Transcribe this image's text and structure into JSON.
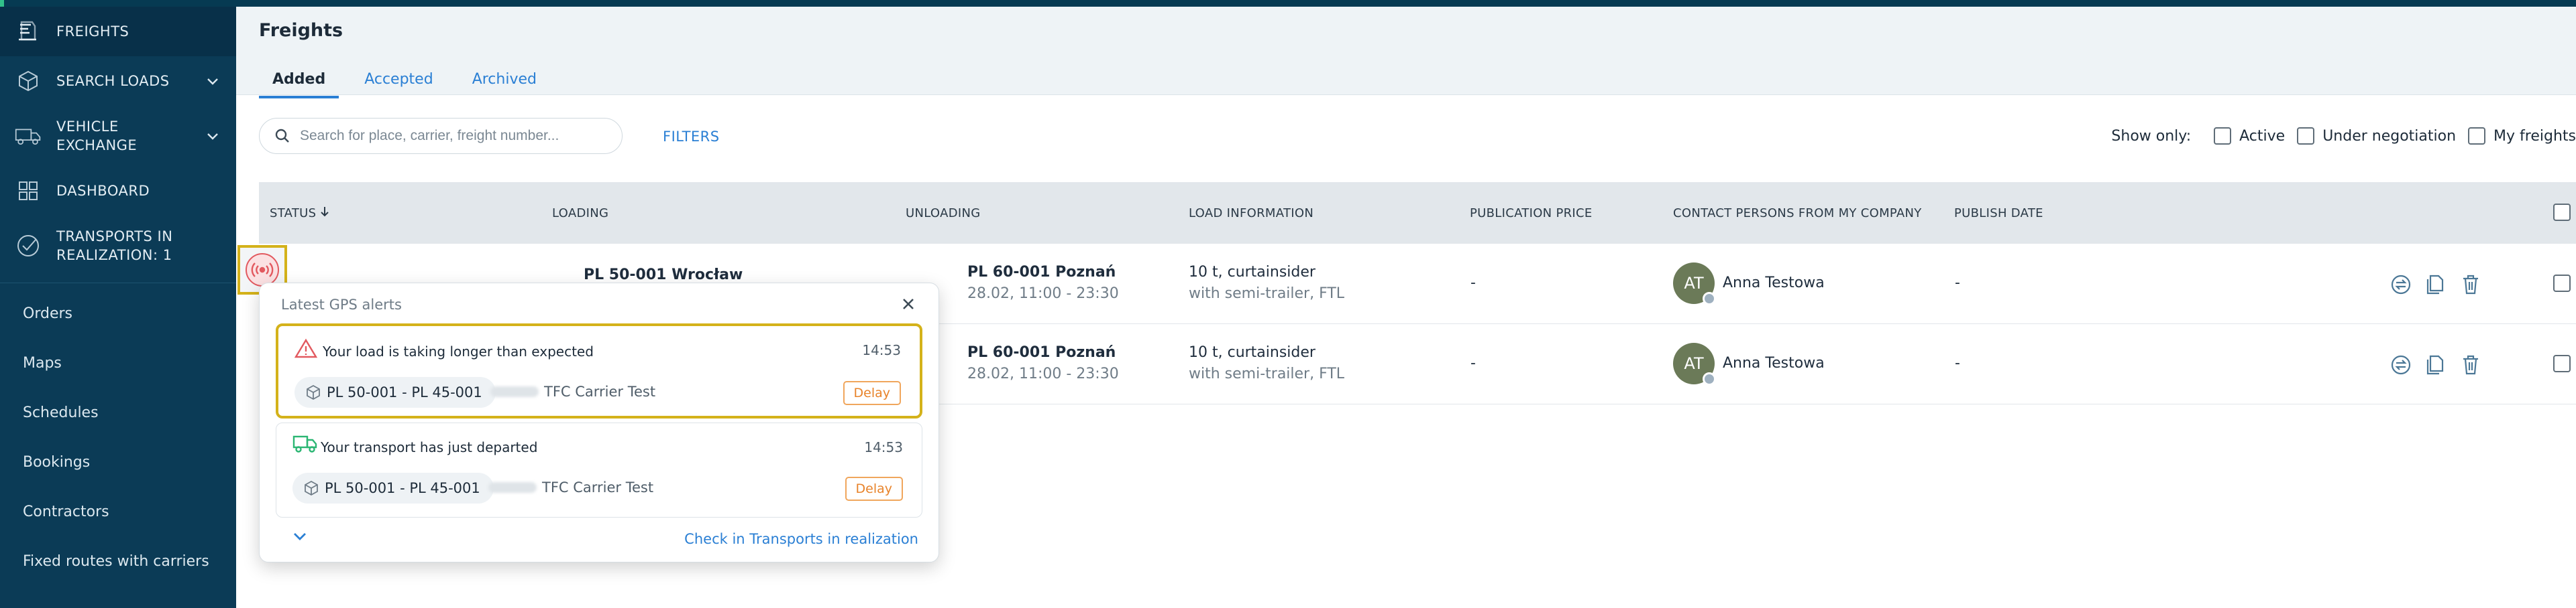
{
  "sidebar": {
    "items": [
      {
        "label": "FREIGHTS",
        "icon": "freights-icon"
      },
      {
        "label": "SEARCH LOADS",
        "icon": "package-icon"
      },
      {
        "label": "VEHICLE EXCHANGE",
        "icon": "truck-icon"
      },
      {
        "label": "DASHBOARD",
        "icon": "dashboard-icon"
      },
      {
        "label": "TRANSPORTS IN REALIZATION: 1",
        "icon": "check-circle-icon"
      }
    ],
    "sub_items": [
      "Orders",
      "Maps",
      "Schedules",
      "Bookings",
      "Contractors",
      "Fixed routes with carriers"
    ]
  },
  "header": {
    "title": "Freights",
    "tabs": [
      "Added",
      "Accepted",
      "Archived"
    ]
  },
  "toolbar": {
    "search_placeholder": "Search for place, carrier, freight number...",
    "filters_label": "FILTERS",
    "show_only_label": "Show only:",
    "options": [
      "Active",
      "Under negotiation",
      "My freights"
    ]
  },
  "table": {
    "columns": [
      "STATUS",
      "LOADING",
      "UNLOADING",
      "LOAD INFORMATION",
      "PUBLICATION PRICE",
      "CONTACT PERSONS FROM MY COMPANY",
      "PUBLISH DATE"
    ],
    "rows": [
      {
        "loading": "PL 50-001 Wrocław",
        "unloading": "PL 60-001 Poznań",
        "unloading_date": "28.02, 11:00 - 23:30",
        "load": "10 t, curtainsider",
        "load_sub": "with semi-trailer, FTL",
        "price": "-",
        "contact_initials": "AT",
        "contact": "Anna Testowa",
        "publish_date": "-"
      },
      {
        "loading": "",
        "unloading": "PL 60-001 Poznań",
        "unloading_date": "28.02, 11:00 - 23:30",
        "load": "10 t, curtainsider",
        "load_sub": "with semi-trailer, FTL",
        "price": "-",
        "contact_initials": "AT",
        "contact": "Anna Testowa",
        "publish_date": "-"
      }
    ]
  },
  "gps_popup": {
    "title": "Latest GPS alerts",
    "alerts": [
      {
        "message": "Your load is taking longer than expected",
        "time": "14:53",
        "route": "PL 50-001 - PL 45-001",
        "carrier": "TFC Carrier Test",
        "badge": "Delay",
        "icon": "warning-triangle-icon"
      },
      {
        "message": "Your transport has just departed",
        "time": "14:53",
        "route": "PL 50-001 - PL 45-001",
        "carrier": "TFC Carrier Test",
        "badge": "Delay",
        "icon": "truck-departed-icon"
      }
    ],
    "link": "Check in Transports in realization"
  },
  "colors": {
    "sidebar_bg": "#0b3b56",
    "accent": "#2a7fd4",
    "highlight": "#d4b21a",
    "alert_red": "#e2595f",
    "delay_orange": "#e8832a",
    "departed_green": "#2bb673"
  }
}
